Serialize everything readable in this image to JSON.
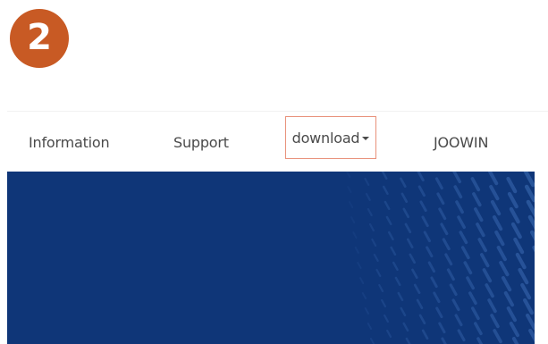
{
  "step": {
    "number": "2",
    "color": "#c85a24"
  },
  "nav": {
    "items": [
      {
        "label": "Information"
      },
      {
        "label": "Support"
      },
      {
        "label": "download",
        "has_dropdown": true,
        "highlighted": true,
        "highlight_color": "#e8917a"
      },
      {
        "label": "JOOWIN"
      }
    ]
  },
  "hero": {
    "background_color": "#0f3678",
    "pattern": "diagonal-dash-wave"
  }
}
